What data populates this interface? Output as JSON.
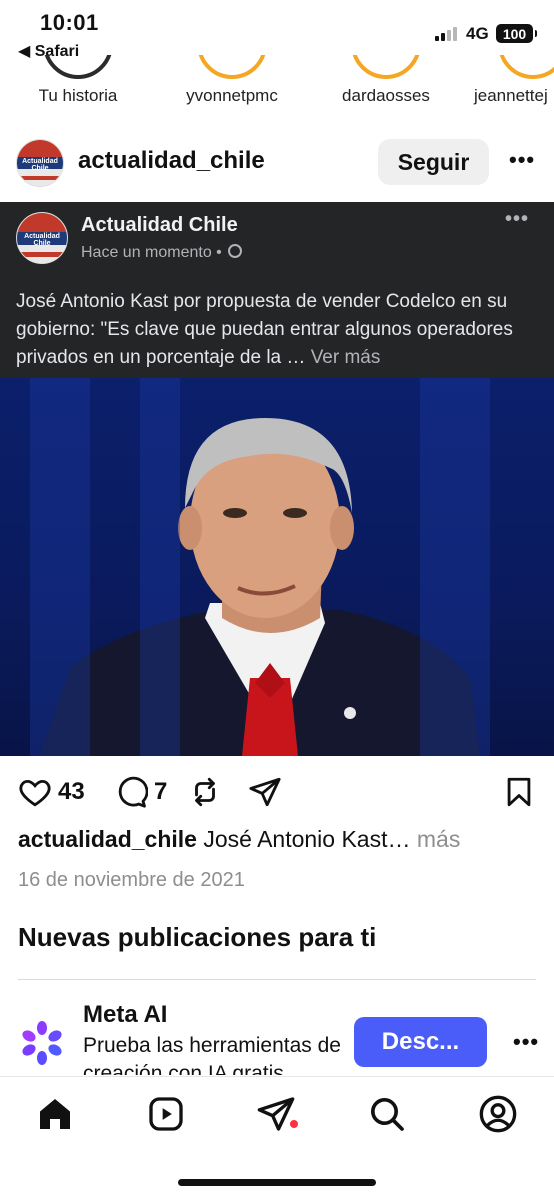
{
  "status_bar": {
    "time": "10:01",
    "back_app": "◀ Safari",
    "network": "4G",
    "battery": "100"
  },
  "stories": [
    {
      "name": "Tu historia"
    },
    {
      "name": "yvonnetpmc"
    },
    {
      "name": "dardaosses"
    },
    {
      "name": "jeannettej"
    }
  ],
  "post": {
    "username": "actualidad_chile",
    "follow_label": "Seguir",
    "more": "•••",
    "avatar_text": "Actualidad Chile",
    "embedded": {
      "page_name": "Actualidad Chile",
      "time": "Hace un momento •",
      "text": "José Antonio Kast por propuesta de vender Codelco en su gobierno: \"Es clave que puedan entrar algunos operadores privados en un porcentaje de la … ",
      "see_more": "Ver más",
      "more": "•••"
    },
    "likes": "43",
    "comments": "7",
    "caption_user": "actualidad_chile",
    "caption_text": "José Antonio Kast…",
    "caption_more": "más",
    "date": "16 de noviembre de 2021"
  },
  "suggestions": {
    "title": "Nuevas publicaciones para ti",
    "meta_ai": {
      "name": "Meta AI",
      "description": "Prueba las herramientas de creación con IA gratis",
      "cta": "Desc...",
      "more": "•••"
    }
  },
  "colors": {
    "cta_blue": "#4a5df9",
    "fb_card_bg": "#242526",
    "notification_red": "#ff3040"
  },
  "icons": {
    "like": "heart-icon",
    "comment": "comment-icon",
    "repost": "repost-icon",
    "share": "send-icon",
    "save": "bookmark-icon",
    "nav": [
      "home-icon",
      "reels-icon",
      "direct-icon",
      "search-icon",
      "profile-icon"
    ]
  }
}
